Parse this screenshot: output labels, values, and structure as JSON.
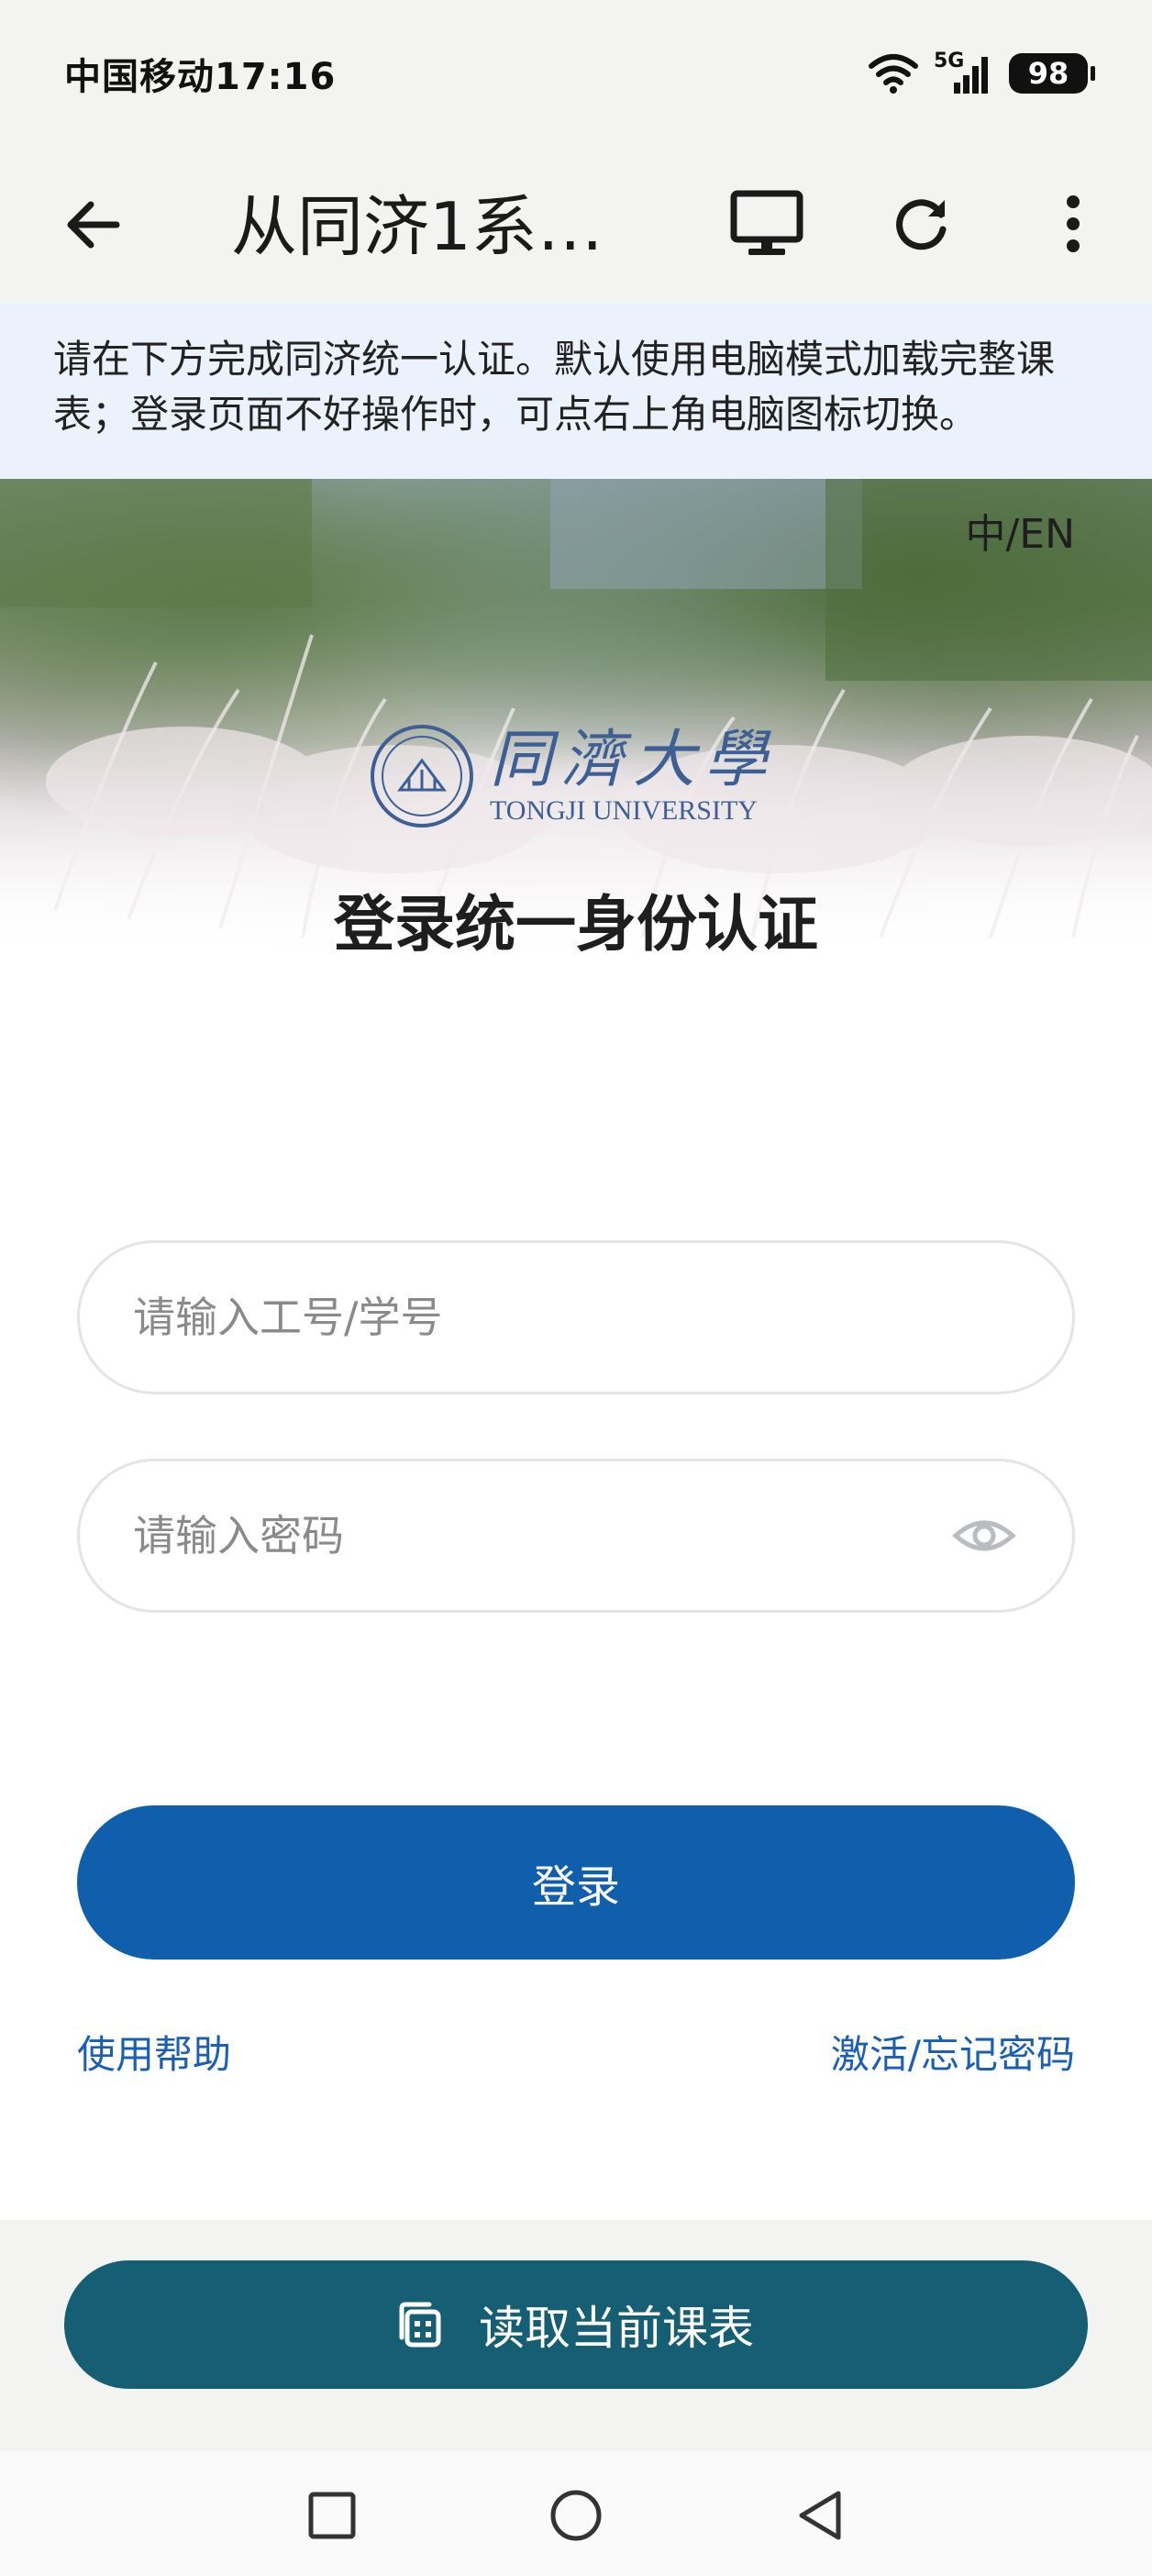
{
  "status_bar": {
    "carrier_time": "中国移动17:16",
    "network": "5G",
    "battery": "98",
    "icons": [
      "wifi-icon",
      "signal-icon",
      "battery-icon"
    ]
  },
  "app_bar": {
    "title": "从同济1系…",
    "icons": [
      "back-arrow-icon",
      "desktop-icon",
      "refresh-icon",
      "more-vertical-icon"
    ]
  },
  "notice": {
    "text": "请在下方完成同济统一认证。默认使用电脑模式加载完整课表；登录页面不好操作时，可点右上角电脑图标切换。"
  },
  "hero": {
    "lang_switch": "中/EN",
    "logo_cn": "同濟大學",
    "logo_en": "TONGJI UNIVERSITY",
    "heading": "登录统一身份认证"
  },
  "form": {
    "username_placeholder": "请输入工号/学号",
    "username_value": "",
    "password_placeholder": "请输入密码",
    "password_value": "",
    "login_label": "登录",
    "help_label": "使用帮助",
    "reset_label": "激活/忘记密码"
  },
  "bottom": {
    "read_button_label": "读取当前课表"
  },
  "colors": {
    "primary_blue": "#0f5fac",
    "read_button_teal": "#165e73",
    "link_blue": "#1a5fb4",
    "notice_bg": "#ecf2fb"
  }
}
